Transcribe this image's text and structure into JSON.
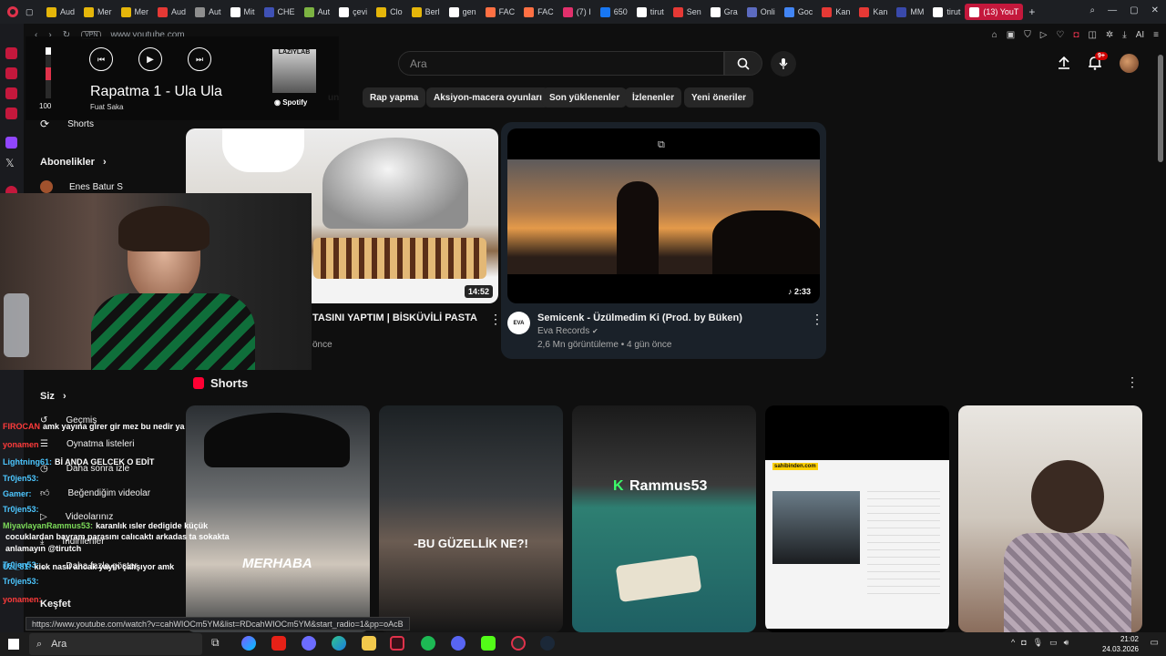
{
  "browser": {
    "tabs": [
      {
        "label": "Aud",
        "color": "#e5b60a"
      },
      {
        "label": "Mer",
        "color": "#e5b60a"
      },
      {
        "label": "Mer",
        "color": "#e5b60a"
      },
      {
        "label": "Aud",
        "color": "#e53935"
      },
      {
        "label": "Aut",
        "color": "#8e8e8e"
      },
      {
        "label": "Mit",
        "color": "#ffffff"
      },
      {
        "label": "CHE",
        "color": "#3f51b5"
      },
      {
        "label": "Aut",
        "color": "#7cb342"
      },
      {
        "label": "çevi",
        "color": "#ffffff"
      },
      {
        "label": "Clo",
        "color": "#e5b60a"
      },
      {
        "label": "Berl",
        "color": "#e5b60a"
      },
      {
        "label": "gen",
        "color": "#ffffff"
      },
      {
        "label": "FAC",
        "color": "#ff7043"
      },
      {
        "label": "FAC",
        "color": "#ff7043"
      },
      {
        "label": "(7) I",
        "color": "#e1306c"
      },
      {
        "label": "650",
        "color": "#1877f2"
      },
      {
        "label": "tirut",
        "color": "#ffffff"
      },
      {
        "label": "Sen",
        "color": "#e53935"
      },
      {
        "label": "Gra",
        "color": "#ffffff"
      },
      {
        "label": "Onli",
        "color": "#5c6bc0"
      },
      {
        "label": "Goc",
        "color": "#4285f4"
      },
      {
        "label": "Kan",
        "color": "#e53935"
      },
      {
        "label": "Kan",
        "color": "#e53935"
      },
      {
        "label": "MM",
        "color": "#3949ab"
      },
      {
        "label": "tirut",
        "color": "#ffffff"
      }
    ],
    "active_tab": "(13) YouT",
    "url": "www.youtube.com",
    "vpn_label": "VPN",
    "status_url": "https://www.youtube.com/watch?v=cahWIOCm5YM&list=RDcahWIOCm5YM&start_radio=1&pp=oAcB",
    "ai_label": "AI"
  },
  "spotify": {
    "track": "Rapatma 1 - Ula Ula",
    "artist": "Fuat Saka",
    "volume": "100",
    "brand": "Spotify",
    "cover_text": "LAZIYLAB"
  },
  "youtube": {
    "search_placeholder": "Ara",
    "notification_count": "9+",
    "chips": [
      "Rap yapma",
      "Aksiyon-macera oyunları",
      "Son yüklenenler",
      "İzlenenler",
      "Yeni öneriler"
    ],
    "chip_partial": "un",
    "sidebar": {
      "shorts": "Shorts",
      "subscriptions_title": "Abonelikler",
      "subscription_channel": "Enes Batur S",
      "you_title": "Siz",
      "you_items": [
        "Geçmiş",
        "Oynatma listeleri",
        "Daha sonra izle",
        "Beğendiğim videolar",
        "Videolarınız",
        "İndirilenler",
        "Daha fazla göster"
      ],
      "explore_title": "Keşfet"
    },
    "videos": [
      {
        "title": "TASINI YAPTIM | BİSKÜVİLİ PASTA",
        "meta": "önce",
        "duration": "14:52"
      },
      {
        "title": "Semicenk - Üzülmedim Ki (Prod. by Büken)",
        "channel": "Eva Records",
        "meta": "2,6 Mn görüntüleme • 4 gün önce",
        "duration": "2:33",
        "avatar_text": "EVA"
      }
    ],
    "shorts_title": "Shorts",
    "shorts": [
      {
        "caption": "MERHABA"
      },
      {
        "caption": "-BU GÜZELLİK NE?!"
      },
      {
        "caption": "Rammus53"
      },
      {
        "caption": "sahibinden.com"
      },
      {
        "caption": ""
      }
    ]
  },
  "chat": [
    {
      "user": "FIROCAN",
      "text": "amk yayına girer gir mez bu nedir ya",
      "color": "#ff3b3b"
    },
    {
      "user": "yonamen",
      "text": "",
      "color": "#ff3b3b"
    },
    {
      "user": "Lightning61:",
      "text": "Bİ ANDA GELCEK O EDİT",
      "color": "#4cc6ff"
    },
    {
      "user": "Tr0jen53:",
      "text": "",
      "color": "#4cc6ff"
    },
    {
      "user": "Gamer:",
      "text": "",
      "color": "#4cc6ff"
    },
    {
      "user": "Tr0jen53:",
      "text": "",
      "color": "#4cc6ff"
    },
    {
      "user": "MiyavlayanRammus53:",
      "text": "karanlık ısler dedigide küçük",
      "color": "#7ddc5a"
    },
    {
      "user": "",
      "text": "cocuklardan bayram parasını calıcaktı arkadas ta sokakta",
      "color": "#ffffff"
    },
    {
      "user": "",
      "text": "anlamayın @tirutch",
      "color": "#ffffff"
    },
    {
      "user": "Tr0jen53:",
      "text": "",
      "color": "#4cc6ff"
    },
    {
      "user": "Uzi_81:",
      "text": "kick nasıl ancak yayın çalışıyor amk",
      "color": "#4cc6ff"
    },
    {
      "user": "Tr0jen53:",
      "text": "",
      "color": "#4cc6ff"
    },
    {
      "user": "yonamen:",
      "text": "",
      "color": "#ff3b3b"
    }
  ],
  "taskbar": {
    "search_label": "Ara",
    "time": "21:02",
    "date": "24.03.2026"
  }
}
